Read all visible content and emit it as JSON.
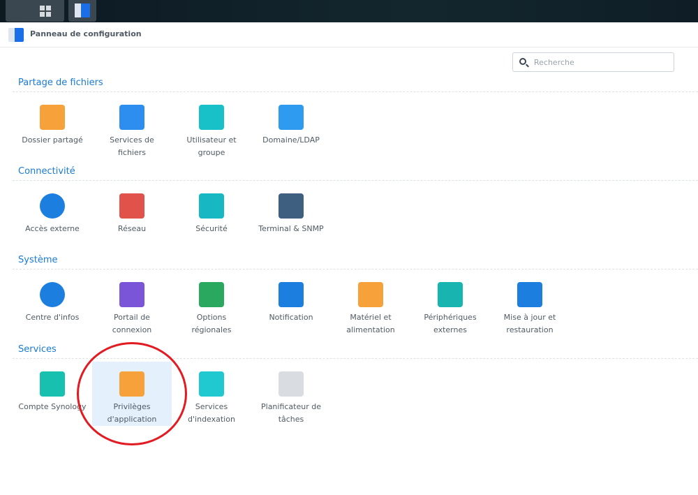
{
  "window": {
    "title": "Panneau de configuration"
  },
  "search": {
    "placeholder": "Recherche"
  },
  "sections": [
    {
      "title": "Partage de fichiers",
      "items": [
        {
          "label1": "Dossier partagé",
          "label2": "",
          "icon": "shared-folder-icon",
          "color": "#f7a13a"
        },
        {
          "label1": "Services de",
          "label2": "fichiers",
          "icon": "file-services-icon",
          "color": "#2e8ef0"
        },
        {
          "label1": "Utilisateur et",
          "label2": "groupe",
          "icon": "user-group-icon",
          "color": "#18c0c8"
        },
        {
          "label1": "Domaine/LDAP",
          "label2": "",
          "icon": "domain-ldap-icon",
          "color": "#2e9af0"
        }
      ]
    },
    {
      "title": "Connectivité",
      "items": [
        {
          "label1": "Accès externe",
          "label2": "",
          "icon": "external-access-icon",
          "color": "#1c7fe0"
        },
        {
          "label1": "Réseau",
          "label2": "",
          "icon": "network-icon",
          "color": "#e0524a"
        },
        {
          "label1": "Sécurité",
          "label2": "",
          "icon": "security-shield-icon",
          "color": "#17b8c4"
        },
        {
          "label1": "Terminal & SNMP",
          "label2": "",
          "icon": "terminal-icon",
          "color": "#3e5f80"
        }
      ]
    },
    {
      "title": "Système",
      "items": [
        {
          "label1": "Centre d'infos",
          "label2": "",
          "icon": "info-center-icon",
          "color": "#1c7fe0"
        },
        {
          "label1": "Portail de",
          "label2": "connexion",
          "icon": "login-portal-icon",
          "color": "#7b55d8"
        },
        {
          "label1": "Options",
          "label2": "régionales",
          "icon": "regional-options-icon",
          "color": "#2aa860"
        },
        {
          "label1": "Notification",
          "label2": "",
          "icon": "notification-icon",
          "color": "#1c7fe0"
        },
        {
          "label1": "Matériel et",
          "label2": "alimentation",
          "icon": "hardware-power-icon",
          "color": "#f7a13a"
        },
        {
          "label1": "Périphériques",
          "label2": "externes",
          "icon": "external-devices-icon",
          "color": "#18b4b0"
        },
        {
          "label1": "Mise à jour et",
          "label2": "restauration",
          "icon": "update-restore-icon",
          "color": "#1c7fe0"
        }
      ]
    },
    {
      "title": "Services",
      "items": [
        {
          "label1": "Compte Synology",
          "label2": "",
          "icon": "synology-account-icon",
          "color": "#18c0b0"
        },
        {
          "label1": "Privilèges",
          "label2": "d'application",
          "icon": "lock-icon",
          "color": "#f7a13a"
        },
        {
          "label1": "Services",
          "label2": "d'indexation",
          "icon": "indexing-search-icon",
          "color": "#20c8d0"
        },
        {
          "label1": "Planificateur de",
          "label2": "tâches",
          "icon": "calendar-icon",
          "color": "#d9dde2"
        }
      ]
    }
  ]
}
